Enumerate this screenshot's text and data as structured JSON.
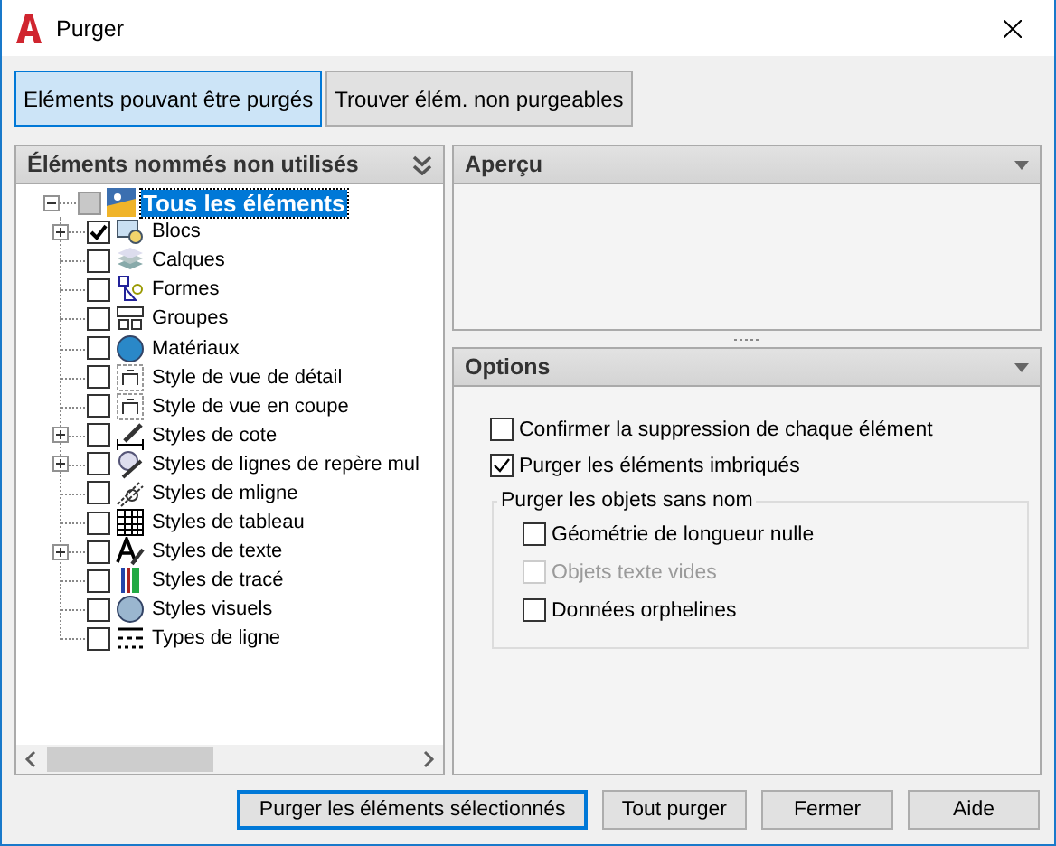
{
  "window": {
    "title": "Purger"
  },
  "tabs": [
    {
      "label": "Eléments pouvant être purgés",
      "selected": true
    },
    {
      "label": "Trouver élém. non purgeables",
      "selected": false
    }
  ],
  "tree_panel": {
    "title": "Éléments nommés non utilisés",
    "root": {
      "label": "Tous les éléments",
      "checked": false,
      "indeterminate": true,
      "selected": true,
      "expanded": true,
      "children": [
        {
          "label": "Blocs",
          "checked": true,
          "expanded": false
        },
        {
          "label": "Calques",
          "checked": false
        },
        {
          "label": "Formes",
          "checked": false
        },
        {
          "label": "Groupes",
          "checked": false
        },
        {
          "label": "Matériaux",
          "checked": false
        },
        {
          "label": "Style de vue de détail",
          "checked": false
        },
        {
          "label": "Style de vue en coupe",
          "checked": false
        },
        {
          "label": "Styles de cote",
          "checked": false,
          "expanded": false
        },
        {
          "label": "Styles de lignes de repère mul",
          "checked": false,
          "expanded": false
        },
        {
          "label": "Styles de mligne",
          "checked": false
        },
        {
          "label": "Styles de tableau",
          "checked": false
        },
        {
          "label": "Styles de texte",
          "checked": false,
          "expanded": false
        },
        {
          "label": "Styles de tracé",
          "checked": false
        },
        {
          "label": "Styles visuels",
          "checked": false
        },
        {
          "label": "Types de ligne",
          "checked": false
        }
      ]
    }
  },
  "preview_panel": {
    "title": "Aperçu"
  },
  "options_panel": {
    "title": "Options",
    "checkboxes": [
      {
        "label": "Confirmer la suppression de chaque élément",
        "checked": false,
        "disabled": false
      },
      {
        "label": "Purger les éléments imbriqués",
        "checked": true,
        "disabled": false
      }
    ],
    "group": {
      "title": "Purger les objets sans nom",
      "checkboxes": [
        {
          "label": "Géométrie de longueur nulle",
          "checked": false,
          "disabled": false
        },
        {
          "label": "Objets texte vides",
          "checked": false,
          "disabled": true
        },
        {
          "label": "Données orphelines",
          "checked": false,
          "disabled": false
        }
      ]
    }
  },
  "buttons": [
    {
      "label": "Purger les éléments sélectionnés",
      "selected": true
    },
    {
      "label": "Tout purger",
      "selected": false
    },
    {
      "label": "Fermer",
      "selected": false
    },
    {
      "label": "Aide",
      "selected": false
    }
  ]
}
